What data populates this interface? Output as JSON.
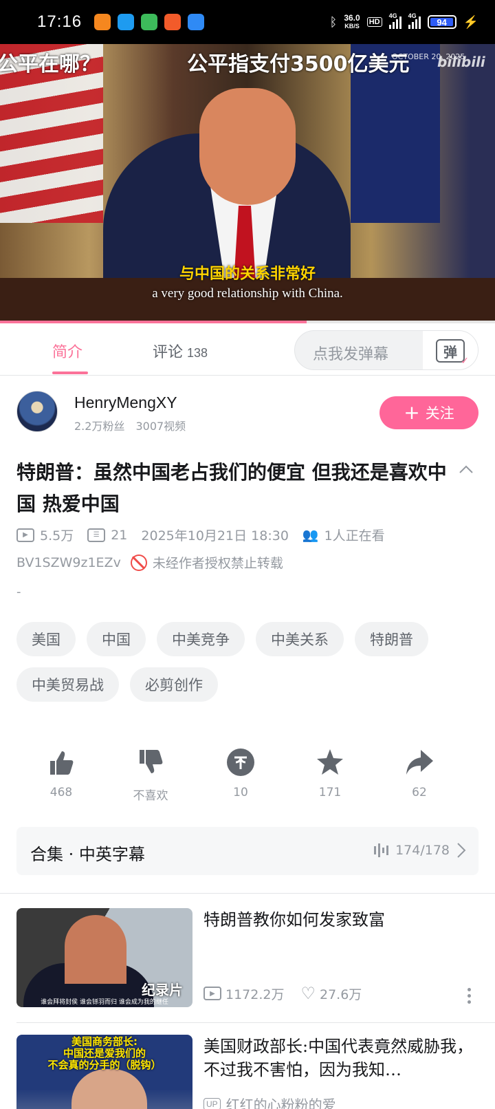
{
  "status_bar": {
    "time": "17:16",
    "net_speed_value": "36.0",
    "net_speed_unit": "KB/S",
    "hd_label": "HD",
    "signal_label_1": "4G",
    "signal_label_2": "4G",
    "battery": "94",
    "notification_icon_colors": [
      "#f5871f",
      "#1e9bf0",
      "#3dbb5b",
      "#f25b2a",
      "#2f8af5"
    ]
  },
  "video": {
    "overlay_left": "公平在哪？",
    "overlay_center": "公平指支付3500亿美元",
    "overlay_date": "OCTOBER 20, 2025",
    "watermark": "bilibili",
    "subtitle_cn": "与中国的关系非常好",
    "subtitle_en": "a very good relationship with China.",
    "progress_fraction": 0.62
  },
  "tabs": {
    "intro": "简介",
    "comments": "评论",
    "comments_count": "138",
    "danmaku_placeholder": "点我发弹幕",
    "danmaku_button": "弹"
  },
  "uploader": {
    "name": "HenryMengXY",
    "fans": "2.2万粉丝",
    "videos": "3007视频",
    "follow_label": "关注"
  },
  "video_info": {
    "title": "特朗普：虽然中国老占我们的便宜 但我还是喜欢中国 热爱中国",
    "views": "5.5万",
    "danmaku_count": "21",
    "publish_time": "2025年10月21日  18:30",
    "watching": "1人正在看",
    "bvid": "BV1SZW9z1EZv",
    "copyright": "未经作者授权禁止转载",
    "description": "-"
  },
  "tags": [
    "美国",
    "中国",
    "中美竞争",
    "中美关系",
    "特朗普",
    "中美贸易战",
    "必剪创作"
  ],
  "actions": {
    "like": "468",
    "dislike": "不喜欢",
    "coin": "10",
    "favorite": "171",
    "share": "62"
  },
  "collection": {
    "title": "合集 · 中英字幕",
    "progress": "174/178"
  },
  "recommendations": [
    {
      "title": "特朗普教你如何发家致富",
      "thumb_badge": "纪录片",
      "thumb_caption": "谁会拜将封侯 谁会铩羽而归 谁会成为我的继任",
      "views": "1172.2万",
      "likes": "27.6万"
    },
    {
      "title": "美国财政部长:中国代表竟然威胁我，不过我不害怕，因为我知…",
      "thumb_text": "美国商务部长:\n中国还是爱我们的\n不会真的分手的（脱钩）",
      "up_badge": "UP",
      "author": "红红的心粉粉的爱"
    }
  ]
}
